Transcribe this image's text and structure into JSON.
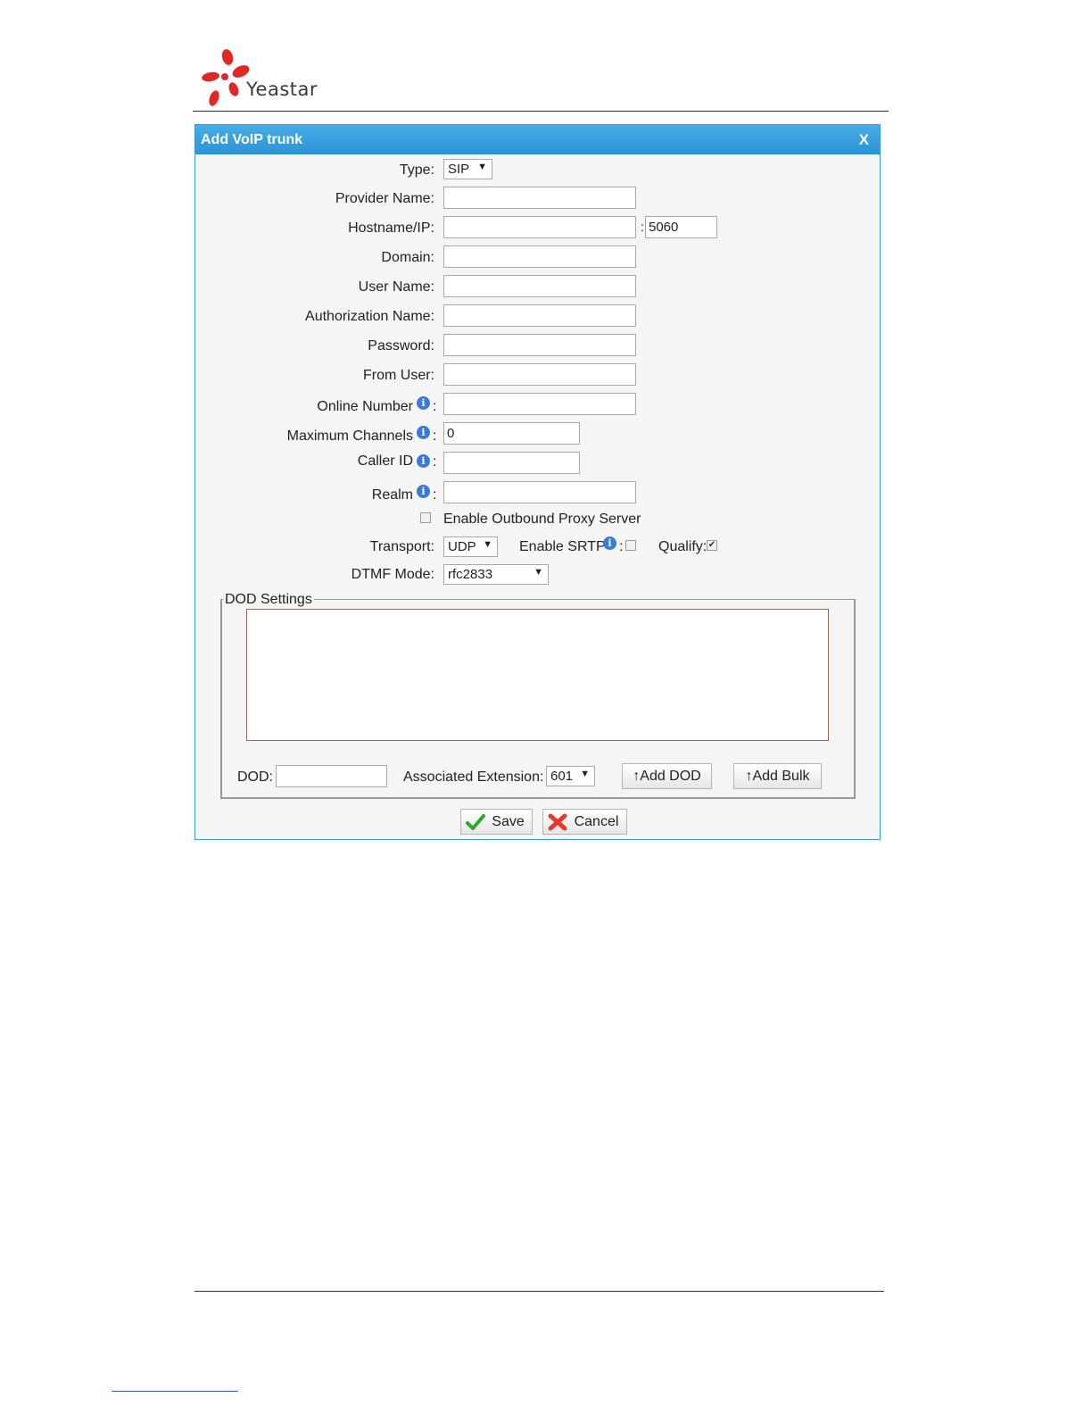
{
  "brand": {
    "name": "Yeastar"
  },
  "dialog": {
    "title": "Add VoIP trunk",
    "close_label": "X",
    "fields": {
      "type": {
        "label": "Type:",
        "value": "SIP"
      },
      "provider_name": {
        "label": "Provider Name:",
        "value": ""
      },
      "hostname": {
        "label": "Hostname/IP:",
        "value": "",
        "port_sep": ":",
        "port": "5060"
      },
      "domain": {
        "label": "Domain:",
        "value": ""
      },
      "user_name": {
        "label": "User Name:",
        "value": ""
      },
      "auth_name": {
        "label": "Authorization Name:",
        "value": ""
      },
      "password": {
        "label": "Password:",
        "value": ""
      },
      "from_user": {
        "label": "From User:",
        "value": ""
      },
      "online_number": {
        "label": "Online Number",
        "value": ""
      },
      "max_channels": {
        "label": "Maximum Channels",
        "value": "0"
      },
      "caller_id": {
        "label": "Caller ID",
        "value": ""
      },
      "realm": {
        "label": "Realm",
        "value": ""
      },
      "label_colon": ":",
      "outbound_proxy": {
        "label": "Enable Outbound Proxy Server",
        "checked": false
      },
      "transport": {
        "label": "Transport:",
        "value": "UDP"
      },
      "srtp": {
        "label": "Enable SRTP",
        "colon": ":",
        "checked": false
      },
      "qualify": {
        "label": "Qualify:",
        "checked": true
      },
      "dtmf_mode": {
        "label": "DTMF Mode:",
        "value": "rfc2833"
      }
    },
    "dod": {
      "legend": "DOD Settings",
      "dod_label": "DOD:",
      "dod_value": "",
      "assoc_label": "Associated Extension:",
      "assoc_value": "601",
      "add_dod": "↑Add DOD",
      "add_bulk": "↑Add Bulk"
    },
    "actions": {
      "save": "Save",
      "cancel": "Cancel"
    }
  }
}
